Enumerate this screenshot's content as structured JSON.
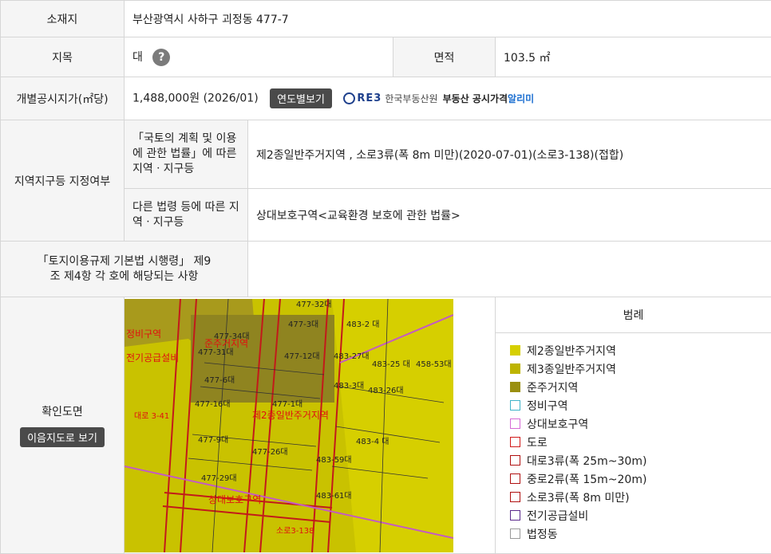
{
  "location": {
    "label": "소재지",
    "value": "부산광역시 사하구 괴정동 477-7"
  },
  "land": {
    "label": "지목",
    "value": "대",
    "help": "?",
    "area_label": "면적",
    "area_value": "103.5 ㎡"
  },
  "price": {
    "label": "개별공시지가(㎡당)",
    "value": "1,488,000원 (2026/01)",
    "button": "연도별보기",
    "reb_logo": "RE3",
    "reb_org": "한국부동산원",
    "reb_service": "부동산 공시가격",
    "reb_alert": "알리미"
  },
  "zoning": {
    "label": "지역지구등 지정여부",
    "national_label": "「국토의 계획 및 이용 에 관한 법률」에 따른 지역ㆍ지구등",
    "national_value": "제2종일반주거지역 , 소로3류(폭 8m 미만)(2020-07-01)(소로3-138)(접합)",
    "other_label": "다른 법령 등에 따른 지역ㆍ지구등",
    "other_value": "상대보호구역<교육환경 보호에 관한 법률>"
  },
  "enforcement": {
    "label": "「토지이용규제 기본법 시행령」 제9조 제4항 각 호에 해당되는 사항",
    "value": ""
  },
  "map": {
    "label": "확인도면",
    "button": "이음지도로 보기",
    "parcels": [
      "477-34대",
      "477-31대",
      "477-3대",
      "477-12대",
      "477-6대",
      "477-16대",
      "477-9대",
      "477-26대",
      "477-29대",
      "483-2 대",
      "483-27대",
      "483-25 대",
      "458-53대",
      "483-26대",
      "483-3대",
      "483-4 대",
      "483-59대",
      "483-61대",
      "477-1대",
      "477-32대"
    ],
    "zone_labels": [
      "준주거지역",
      "정비구역",
      "전기공급설비",
      "제2종일반주거지역",
      "상대보호구역",
      "대로 3-41",
      "소로3-138"
    ]
  },
  "legend": {
    "title": "범례",
    "items": [
      {
        "label": "제2종일반주거지역",
        "fill": "#d6cf00",
        "border": "#d6cf00"
      },
      {
        "label": "제3종일반주거지역",
        "fill": "#bdb400",
        "border": "#bdb400"
      },
      {
        "label": "준주거지역",
        "fill": "#9a8f10",
        "border": "#9a8f10"
      },
      {
        "label": "정비구역",
        "fill": "#ffffff",
        "border": "#3fb3c9"
      },
      {
        "label": "상대보호구역",
        "fill": "#ffffff",
        "border": "#d66ad6"
      },
      {
        "label": "도로",
        "fill": "#ffffff",
        "border": "#d11a1a"
      },
      {
        "label": "대로3류(폭 25m~30m)",
        "fill": "#ffffff",
        "border": "#b01010"
      },
      {
        "label": "중로2류(폭 15m~20m)",
        "fill": "#ffffff",
        "border": "#b01010"
      },
      {
        "label": "소로3류(폭 8m 미만)",
        "fill": "#ffffff",
        "border": "#b01010"
      },
      {
        "label": "전기공급설비",
        "fill": "#ffffff",
        "border": "#5b2a8c"
      },
      {
        "label": "법정동",
        "fill": "#ffffff",
        "border": "#9a9a9a"
      }
    ]
  }
}
